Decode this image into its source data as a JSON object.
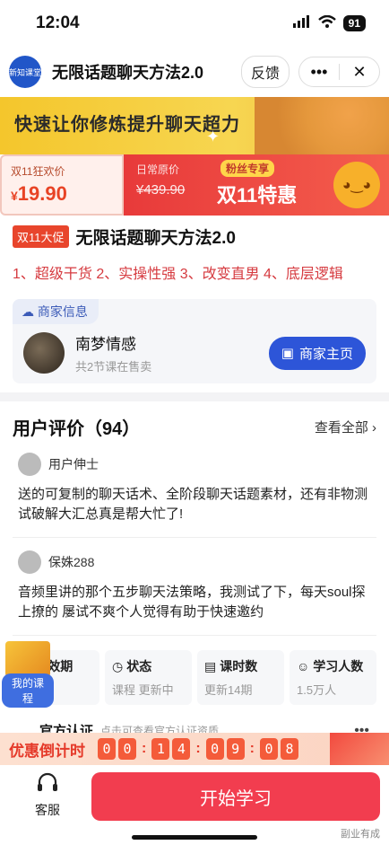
{
  "status": {
    "time": "12:04",
    "battery": "91"
  },
  "nav": {
    "logo_text": "新知课堂",
    "title": "无限话题聊天方法2.0",
    "feedback": "反馈",
    "more": "•••",
    "close": "✕"
  },
  "banner": {
    "text": "快速让你修炼提升聊天超力"
  },
  "price": {
    "left_label": "双11狂欢价",
    "currency": "¥",
    "amount": "19.90",
    "orig_label": "日常原价",
    "orig_value": "¥439.90",
    "fans_tag": "粉丝专享",
    "promo": "双11特惠"
  },
  "course": {
    "tag": "双11大促",
    "title": "无限话题聊天方法2.0",
    "subtitle": "1、超级干货 2、实操性强 3、改变直男 4、底层逻辑"
  },
  "merchant": {
    "header": "商家信息",
    "name": "南梦情感",
    "sub": "共2节课在售卖",
    "button": "商家主页"
  },
  "reviews": {
    "title": "用户评价（94）",
    "view_all": "查看全部",
    "items": [
      {
        "user": "用户伸士",
        "text": "送的可复制的聊天话术、全阶段聊天话题素材，还有非物测试破解大汇总真是帮大忙了!"
      },
      {
        "user": "保姝288",
        "text": "音频里讲的那个五步聊天法策略，我测试了下，每天soul探上撩的 屡试不爽个人觉得有助于快速邀约"
      }
    ]
  },
  "stats": [
    {
      "title": "有效期",
      "value": "有效"
    },
    {
      "title": "状态",
      "value": "课程 更新中"
    },
    {
      "title": "课时数",
      "value": "更新14期"
    },
    {
      "title": "学习人数",
      "value": "1.5万人"
    }
  ],
  "cert": {
    "title": "官方认证",
    "sub": "点击可查看官方认证资质",
    "dots": "•••"
  },
  "my_course": {
    "label": "我的课程"
  },
  "countdown": {
    "label": "优惠倒计时",
    "d": [
      "0",
      "0",
      "1",
      "4",
      "0",
      "9",
      "0",
      "8"
    ]
  },
  "bottom": {
    "service": "客服",
    "start": "开始学习"
  },
  "watermark": "副业有成",
  "colors": {
    "accent": "#2d55d8",
    "promo_red": "#f23d4f"
  }
}
